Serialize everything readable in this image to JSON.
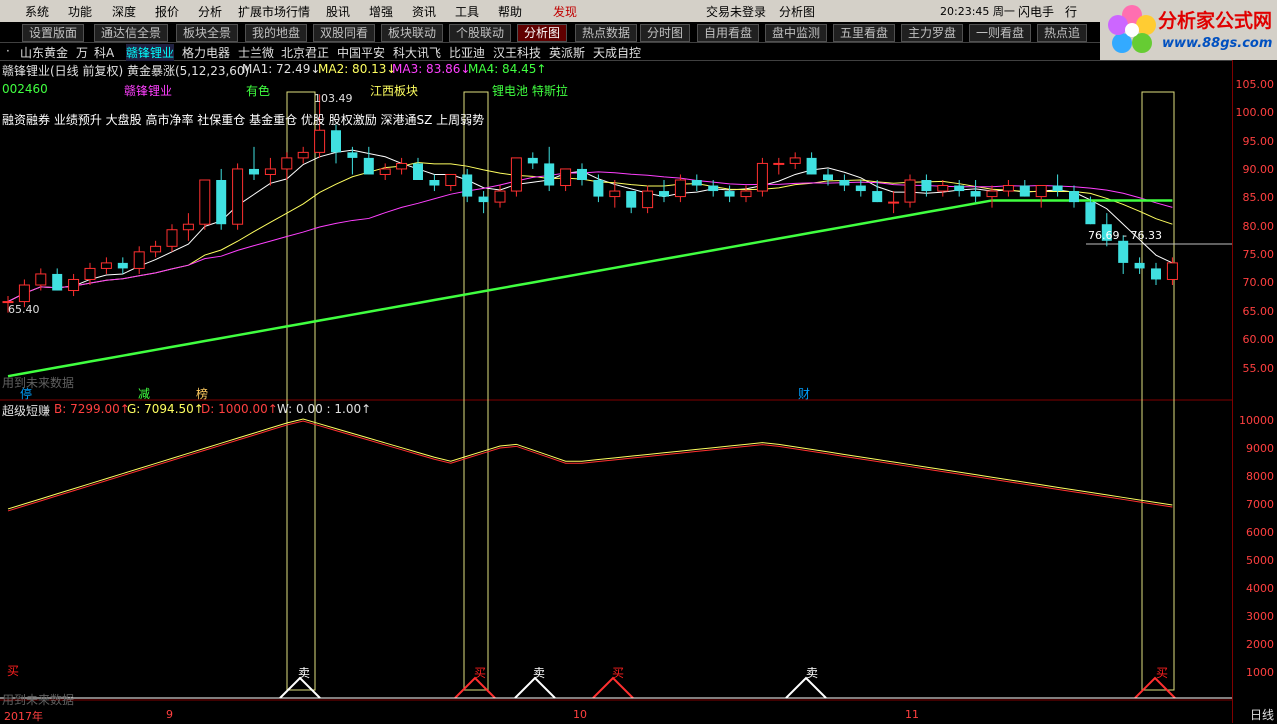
{
  "menu": [
    "系统",
    "功能",
    "深度",
    "报价",
    "分析",
    "扩展市场行情",
    "股讯",
    "增强",
    "资讯",
    "工具",
    "帮助",
    "发现"
  ],
  "status": {
    "login": "交易未登录",
    "view": "分析图",
    "time": "20:23:45 周一",
    "btn1": "闪电手",
    "btn2": "行"
  },
  "logo": {
    "name": "分析家公式网",
    "url": "www.88gs.com"
  },
  "tabs": [
    "设置版面",
    "通达信全景",
    "板块全景",
    "我的地盘",
    "双股同看",
    "板块联动",
    "个股联动",
    "分析图",
    "热点数据",
    "分时图",
    "自用看盘",
    "盘中监测",
    "五里看盘",
    "主力罗盘",
    "一则看盘",
    "热点追"
  ],
  "active_tab": "分析图",
  "stocks": [
    "·",
    "山东黄金",
    "万",
    "科A",
    "赣锋锂业",
    "格力电器",
    "士兰微",
    "北京君正",
    "中国平安",
    "科大讯飞",
    "比亚迪",
    "汉王科技",
    "英派斯",
    "天成自控"
  ],
  "active_stock": "赣锋锂业",
  "header": {
    "title": "赣锋锂业(日线 前复权) 黄金暴涨(5,12,23,60)",
    "ma1": "MA1: 72.49↓",
    "ma2": "MA2: 80.13↓",
    "ma3": "MA3: 83.86↓",
    "ma4": "MA4: 84.45↑"
  },
  "info": {
    "code": "002460",
    "name": "赣锋锂业",
    "sector1": "有色",
    "sector2": "江西板块",
    "sector3": "锂电池 特斯拉",
    "tags": "融资融券 业绩预升 大盘股 高市净率 社保重仓 基金重仓 优股 股权激励 深港通SZ 上周弱势"
  },
  "annot": {
    "high": "103.49",
    "low": "65.40",
    "range": "76.69 - 76.33",
    "nodata": "用到未来数据",
    "stop": "停",
    "reduce": "减",
    "rank": "榜",
    "fin": "财"
  },
  "indicator": {
    "name": "超级短赚",
    "b": "B: 7299.00↑",
    "g": "G: 7094.50↑",
    "d": "D: 1000.00↑",
    "w": "W: 0.00 : 1.00↑"
  },
  "signals": {
    "buy": "买",
    "sell": "卖"
  },
  "xaxis": {
    "y2017": "2017年",
    "m9": "9",
    "m10": "10",
    "m11": "11",
    "period": "日线"
  },
  "price_axis": [
    "105.00",
    "100.00",
    "95.00",
    "90.00",
    "85.00",
    "80.00",
    "75.00",
    "70.00",
    "65.00",
    "60.00",
    "55.00"
  ],
  "ind_axis": [
    "10000",
    "9000",
    "8000",
    "7000",
    "6000",
    "5000",
    "4000",
    "3000",
    "2000",
    "1000"
  ],
  "chart_data": {
    "type": "candlestick",
    "ylim": [
      50,
      107
    ],
    "candles": [
      [
        66,
        67,
        64,
        66
      ],
      [
        66,
        70,
        65,
        69
      ],
      [
        69,
        72,
        68,
        71
      ],
      [
        71,
        72,
        68,
        68
      ],
      [
        68,
        71,
        67,
        70
      ],
      [
        70,
        73,
        69,
        72
      ],
      [
        72,
        74,
        71,
        73
      ],
      [
        73,
        74,
        71,
        72
      ],
      [
        72,
        76,
        71,
        75
      ],
      [
        75,
        77,
        74,
        76
      ],
      [
        76,
        80,
        75,
        79
      ],
      [
        79,
        82,
        77,
        80
      ],
      [
        80,
        88,
        79,
        88
      ],
      [
        88,
        90,
        79,
        80
      ],
      [
        80,
        91,
        79,
        90
      ],
      [
        90,
        94,
        88,
        89
      ],
      [
        89,
        92,
        87,
        90
      ],
      [
        90,
        93,
        88,
        92
      ],
      [
        92,
        94,
        91,
        93
      ],
      [
        93,
        103.49,
        92,
        97
      ],
      [
        97,
        98,
        91,
        93
      ],
      [
        93,
        94,
        89,
        92
      ],
      [
        92,
        94,
        89,
        89
      ],
      [
        89,
        91,
        88,
        90
      ],
      [
        90,
        92,
        89,
        91
      ],
      [
        91,
        92,
        88,
        88
      ],
      [
        88,
        89,
        86,
        87
      ],
      [
        87,
        89,
        86,
        89
      ],
      [
        89,
        90,
        84,
        85
      ],
      [
        85,
        86,
        82,
        84
      ],
      [
        84,
        87,
        83,
        86
      ],
      [
        86,
        92,
        85,
        92
      ],
      [
        92,
        93,
        90,
        91
      ],
      [
        91,
        94,
        86,
        87
      ],
      [
        87,
        90,
        86,
        90
      ],
      [
        90,
        91,
        87,
        88
      ],
      [
        88,
        89,
        84,
        85
      ],
      [
        85,
        88,
        83,
        86
      ],
      [
        86,
        86,
        82,
        83
      ],
      [
        83,
        87,
        82,
        86
      ],
      [
        86,
        88,
        84,
        85
      ],
      [
        85,
        89,
        84,
        88
      ],
      [
        88,
        89,
        86,
        87
      ],
      [
        87,
        88,
        85,
        86
      ],
      [
        86,
        87,
        84,
        85
      ],
      [
        85,
        87,
        84,
        86
      ],
      [
        86,
        92,
        85,
        91
      ],
      [
        91,
        92,
        89,
        91
      ],
      [
        91,
        93,
        90,
        92
      ],
      [
        92,
        93,
        89,
        89
      ],
      [
        89,
        90,
        87,
        88
      ],
      [
        88,
        89,
        86,
        87
      ],
      [
        87,
        88,
        85,
        86
      ],
      [
        86,
        88,
        84,
        84
      ],
      [
        84,
        86,
        82,
        84
      ],
      [
        84,
        89,
        83,
        88
      ],
      [
        88,
        89,
        85,
        86
      ],
      [
        86,
        88,
        85,
        87
      ],
      [
        87,
        88,
        85,
        86
      ],
      [
        86,
        88,
        84,
        85
      ],
      [
        85,
        87,
        83,
        86
      ],
      [
        86,
        88,
        85,
        87
      ],
      [
        87,
        88,
        85,
        85
      ],
      [
        85,
        87,
        83,
        87
      ],
      [
        87,
        89,
        85,
        86
      ],
      [
        86,
        87,
        83,
        84
      ],
      [
        84,
        85,
        80,
        80
      ],
      [
        80,
        82,
        76,
        77
      ],
      [
        77,
        78,
        71,
        73
      ],
      [
        73,
        74,
        71,
        72
      ],
      [
        72,
        73,
        69,
        70
      ],
      [
        70,
        74,
        69,
        73
      ]
    ]
  }
}
